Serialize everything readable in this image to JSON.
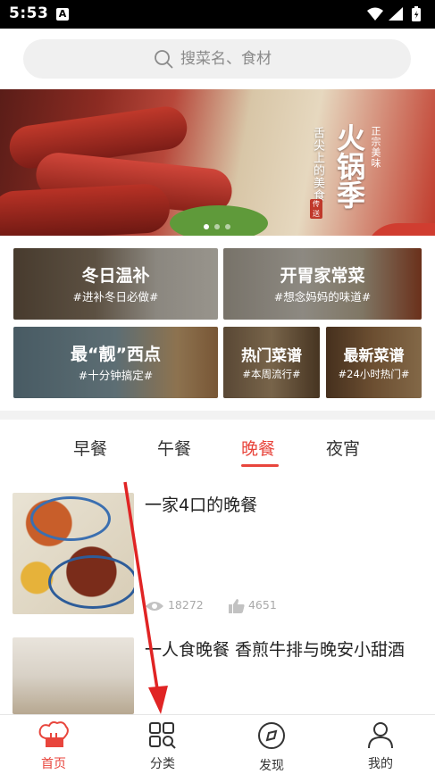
{
  "status_bar": {
    "time": "5:53",
    "notification_glyph": "A"
  },
  "search": {
    "placeholder": "搜菜名、食材"
  },
  "banner": {
    "title": "火锅季",
    "subtitle": "舌尖上的美食",
    "side_text": "正宗美味",
    "seal_text": "传送",
    "slide_count": 3,
    "active_slide": 1
  },
  "categories": [
    {
      "title": "冬日温补",
      "subtitle": "#进补冬日必做#"
    },
    {
      "title": "开胃家常菜",
      "subtitle": "#想念妈妈的味道#"
    },
    {
      "title": "最“靓”西点",
      "subtitle": "#十分钟搞定#"
    },
    {
      "title": "热门菜谱",
      "subtitle": "#本周流行#"
    },
    {
      "title": "最新菜谱",
      "subtitle": "#24小时热门#"
    }
  ],
  "meal_tabs": [
    {
      "label": "早餐",
      "active": false
    },
    {
      "label": "午餐",
      "active": false
    },
    {
      "label": "晚餐",
      "active": true
    },
    {
      "label": "夜宵",
      "active": false
    }
  ],
  "recipes": [
    {
      "title": "一家4口的晚餐",
      "views": "18272",
      "likes": "4651"
    },
    {
      "title": "一人食晚餐 香煎牛排与晚安小甜酒"
    }
  ],
  "bottom_nav": [
    {
      "label": "首页",
      "icon": "chef-hat-icon",
      "active": true
    },
    {
      "label": "分类",
      "icon": "grid-search-icon",
      "active": false
    },
    {
      "label": "发现",
      "icon": "compass-icon",
      "active": false
    },
    {
      "label": "我的",
      "icon": "user-icon",
      "active": false
    }
  ],
  "colors": {
    "accent": "#e8453c",
    "status_bar": "#000000",
    "search_bg": "#f0f0f0"
  }
}
